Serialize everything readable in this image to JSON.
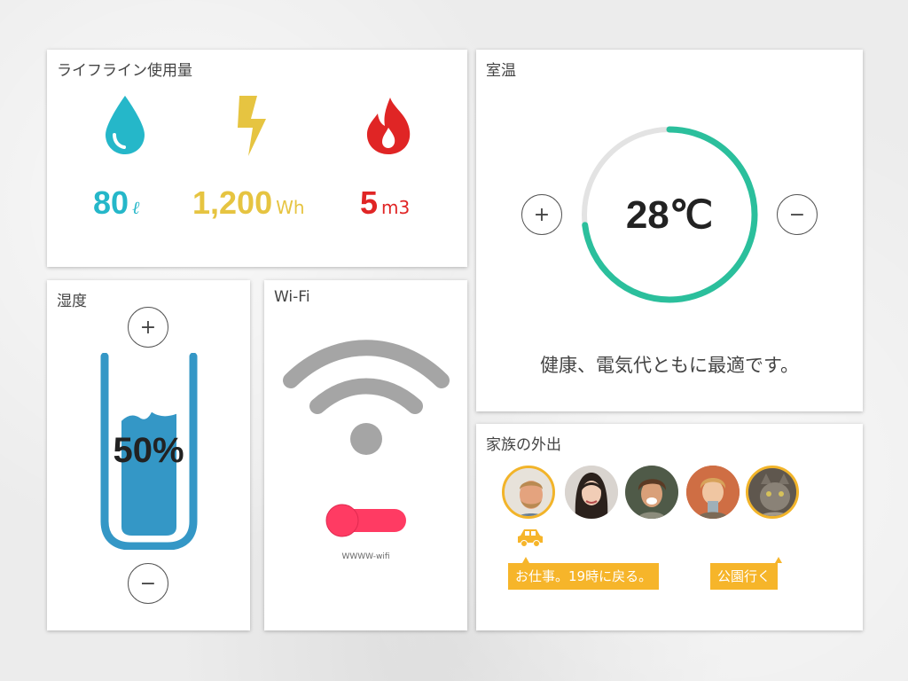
{
  "lifeline": {
    "title": "ライフライン使用量",
    "items": [
      {
        "icon": "water-drop-icon",
        "value": "80",
        "unit": "ℓ",
        "color": "#25b7c9"
      },
      {
        "icon": "lightning-icon",
        "value": "1,200",
        "unit": "Wh",
        "color": "#e6c441"
      },
      {
        "icon": "flame-icon",
        "value": "5",
        "unit": "m3",
        "color": "#e02525"
      }
    ]
  },
  "room_temp": {
    "title": "室温",
    "value": "28℃",
    "level": 0.73,
    "plus_label": "+",
    "minus_label": "−",
    "message": "健康、電気代ともに最適です。",
    "ring_color": "#2bbf9c",
    "track_color": "#e3e3e3"
  },
  "humidity": {
    "title": "湿度",
    "value": "50%",
    "level": 0.5,
    "plus_label": "+",
    "minus_label": "−",
    "color": "#3497c6"
  },
  "wifi": {
    "title": "Wi-Fi",
    "network_name": "WWWW-wifi",
    "toggle_on": false,
    "icon_color": "#a5a5a5",
    "toggle_color": "#ff3b63"
  },
  "family": {
    "title": "家族の外出",
    "members": [
      {
        "name": "father",
        "at_home": true
      },
      {
        "name": "mother",
        "at_home": false
      },
      {
        "name": "son",
        "at_home": false
      },
      {
        "name": "child",
        "at_home": false
      },
      {
        "name": "cat",
        "at_home": true
      }
    ],
    "car_icon": "car-icon",
    "messages": [
      "お仕事。19時に戻る。",
      "公園行く"
    ],
    "accent_color": "#f6b52a"
  }
}
